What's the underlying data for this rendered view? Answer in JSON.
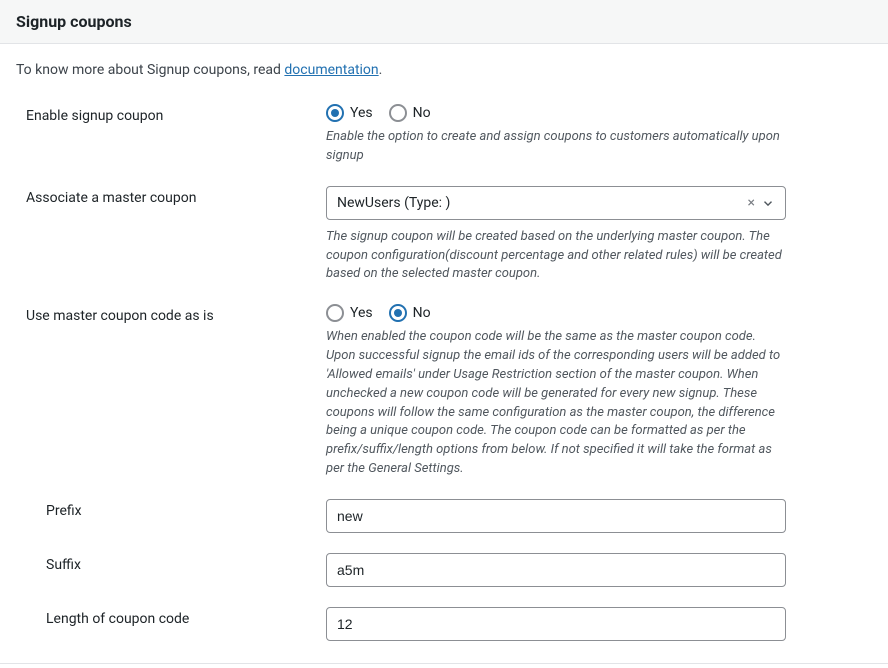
{
  "header": {
    "title": "Signup coupons"
  },
  "intro": {
    "prefix": "To know more about Signup coupons, read ",
    "link_text": "documentation",
    "suffix": "."
  },
  "labels": {
    "yes": "Yes",
    "no": "No"
  },
  "fields": {
    "enable": {
      "label": "Enable signup coupon",
      "value": "yes",
      "help": "Enable the option to create and assign coupons to customers automatically upon signup"
    },
    "master": {
      "label": "Associate a master coupon",
      "selected": "NewUsers (Type: )",
      "help": "The signup coupon will be created based on the underlying master coupon. The coupon configuration(discount percentage and other related rules) will be created based on the selected master coupon."
    },
    "use_as_is": {
      "label": "Use master coupon code as is",
      "value": "no",
      "help": "When enabled the coupon code will be the same as the master coupon code. Upon successful signup the email ids of the corresponding users will be added to 'Allowed emails' under Usage Restriction section of the master coupon. When unchecked a new coupon code will be generated for every new signup. These coupons will follow the same configuration as the master coupon, the difference being a unique coupon code. The coupon code can be formatted as per the prefix/suffix/length options from below. If not specified it will take the format as per the General Settings."
    },
    "prefix": {
      "label": "Prefix",
      "value": "new"
    },
    "suffix": {
      "label": "Suffix",
      "value": "a5m"
    },
    "length": {
      "label": "Length of coupon code",
      "value": "12"
    }
  }
}
